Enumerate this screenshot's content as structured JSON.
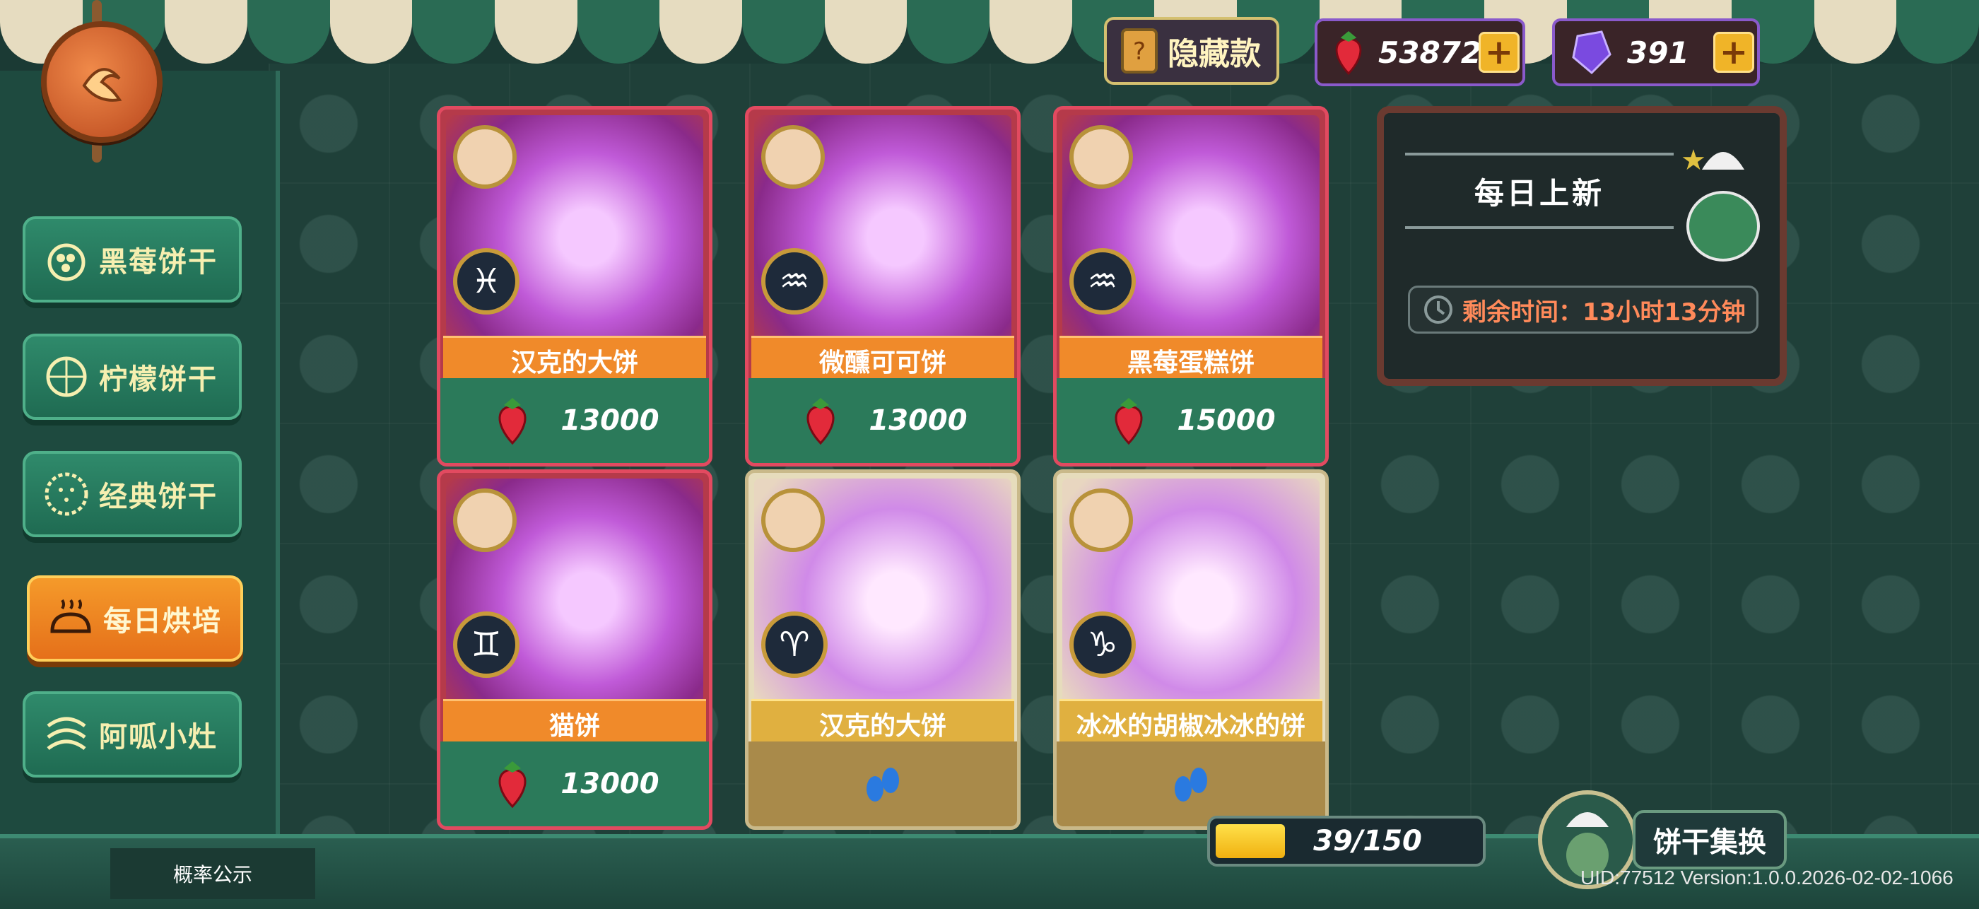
{
  "header": {
    "hidden_label": "隐藏款",
    "strawberry_count": "53872",
    "gem_count": "391",
    "plus_symbol": "+"
  },
  "sidebar": {
    "items": [
      {
        "label": "黑莓饼干",
        "icon": "blackberry-icon",
        "active": false
      },
      {
        "label": "柠檬饼干",
        "icon": "lemon-icon",
        "active": false
      },
      {
        "label": "经典饼干",
        "icon": "cookie-icon",
        "active": false
      },
      {
        "label": "每日烘培",
        "icon": "bread-icon",
        "active": true
      },
      {
        "label": "阿呱小灶",
        "icon": "stove-icon",
        "active": false
      }
    ],
    "probability_label": "概率公示"
  },
  "cards": [
    {
      "name": "汉克的大饼",
      "zodiac": "♓",
      "price": "13000",
      "style": "red",
      "owned": false
    },
    {
      "name": "微醺可可饼",
      "zodiac": "♒",
      "price": "13000",
      "style": "red",
      "owned": false
    },
    {
      "name": "黑莓蛋糕饼",
      "zodiac": "♒",
      "price": "15000",
      "style": "red",
      "owned": false
    },
    {
      "name": "猫饼",
      "zodiac": "♊",
      "price": "13000",
      "style": "red",
      "owned": false
    },
    {
      "name": "汉克的大饼",
      "zodiac": "♈",
      "price": "",
      "style": "gold",
      "owned": true
    },
    {
      "name": "冰冰的胡椒冰冰的饼",
      "zodiac": "♑",
      "price": "",
      "style": "gold",
      "owned": true
    }
  ],
  "daily": {
    "title": "每日上新",
    "timer_label": "剩余时间：13小时13分钟"
  },
  "progress": {
    "text": "39/150",
    "current": 39,
    "max": 150
  },
  "exchange_label": "饼干集换",
  "version_text": "UID:77512 Version:1.0.0.2026-02-02-1066",
  "colors": {
    "accent_orange": "#f08a2a",
    "card_red": "#b53a4a",
    "card_gold": "#e6dcbc",
    "menu_green": "#2f8a6b"
  }
}
